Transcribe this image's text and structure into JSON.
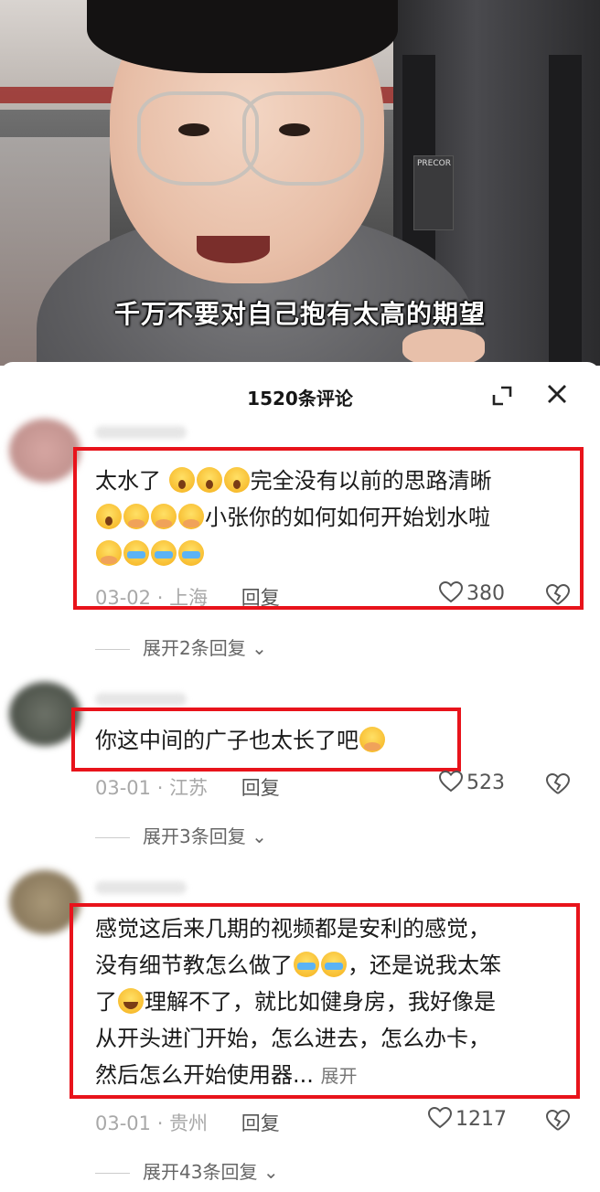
{
  "video": {
    "subtitle": "千万不要对自己抱有太高的期望",
    "machine_brand": "PRECOR"
  },
  "sheet": {
    "title": "1520条评论",
    "expand_icon": "fullscreen-icon",
    "close_icon": "close-icon"
  },
  "comments": [
    {
      "parts": [
        "太水了 ",
        "完全没有以前的思路清晰",
        "小张你的如何如何开始划水啦"
      ],
      "date": "03-02",
      "location": "上海",
      "reply_label": "回复",
      "likes": "380",
      "replies": "展开2条回复"
    },
    {
      "parts": [
        "你这中间的广子也太长了吧"
      ],
      "date": "03-01",
      "location": "江苏",
      "reply_label": "回复",
      "likes": "523",
      "replies": "展开3条回复"
    },
    {
      "lines": [
        "感觉这后来几期的视频都是安利的感觉，",
        "没有细节教怎么做了",
        "，还是说我太笨",
        "了",
        "理解不了，就比如健身房，我好像是",
        "从开头进门开始，怎么进去，怎么办卡，",
        "然后怎么开始使用器..."
      ],
      "unfold": "展开",
      "date": "03-01",
      "location": "贵州",
      "reply_label": "回复",
      "likes": "1217",
      "replies": "展开43条回复"
    }
  ],
  "colors": {
    "highlight_box": "#e8131b",
    "meta_text": "#a8a8a8"
  }
}
